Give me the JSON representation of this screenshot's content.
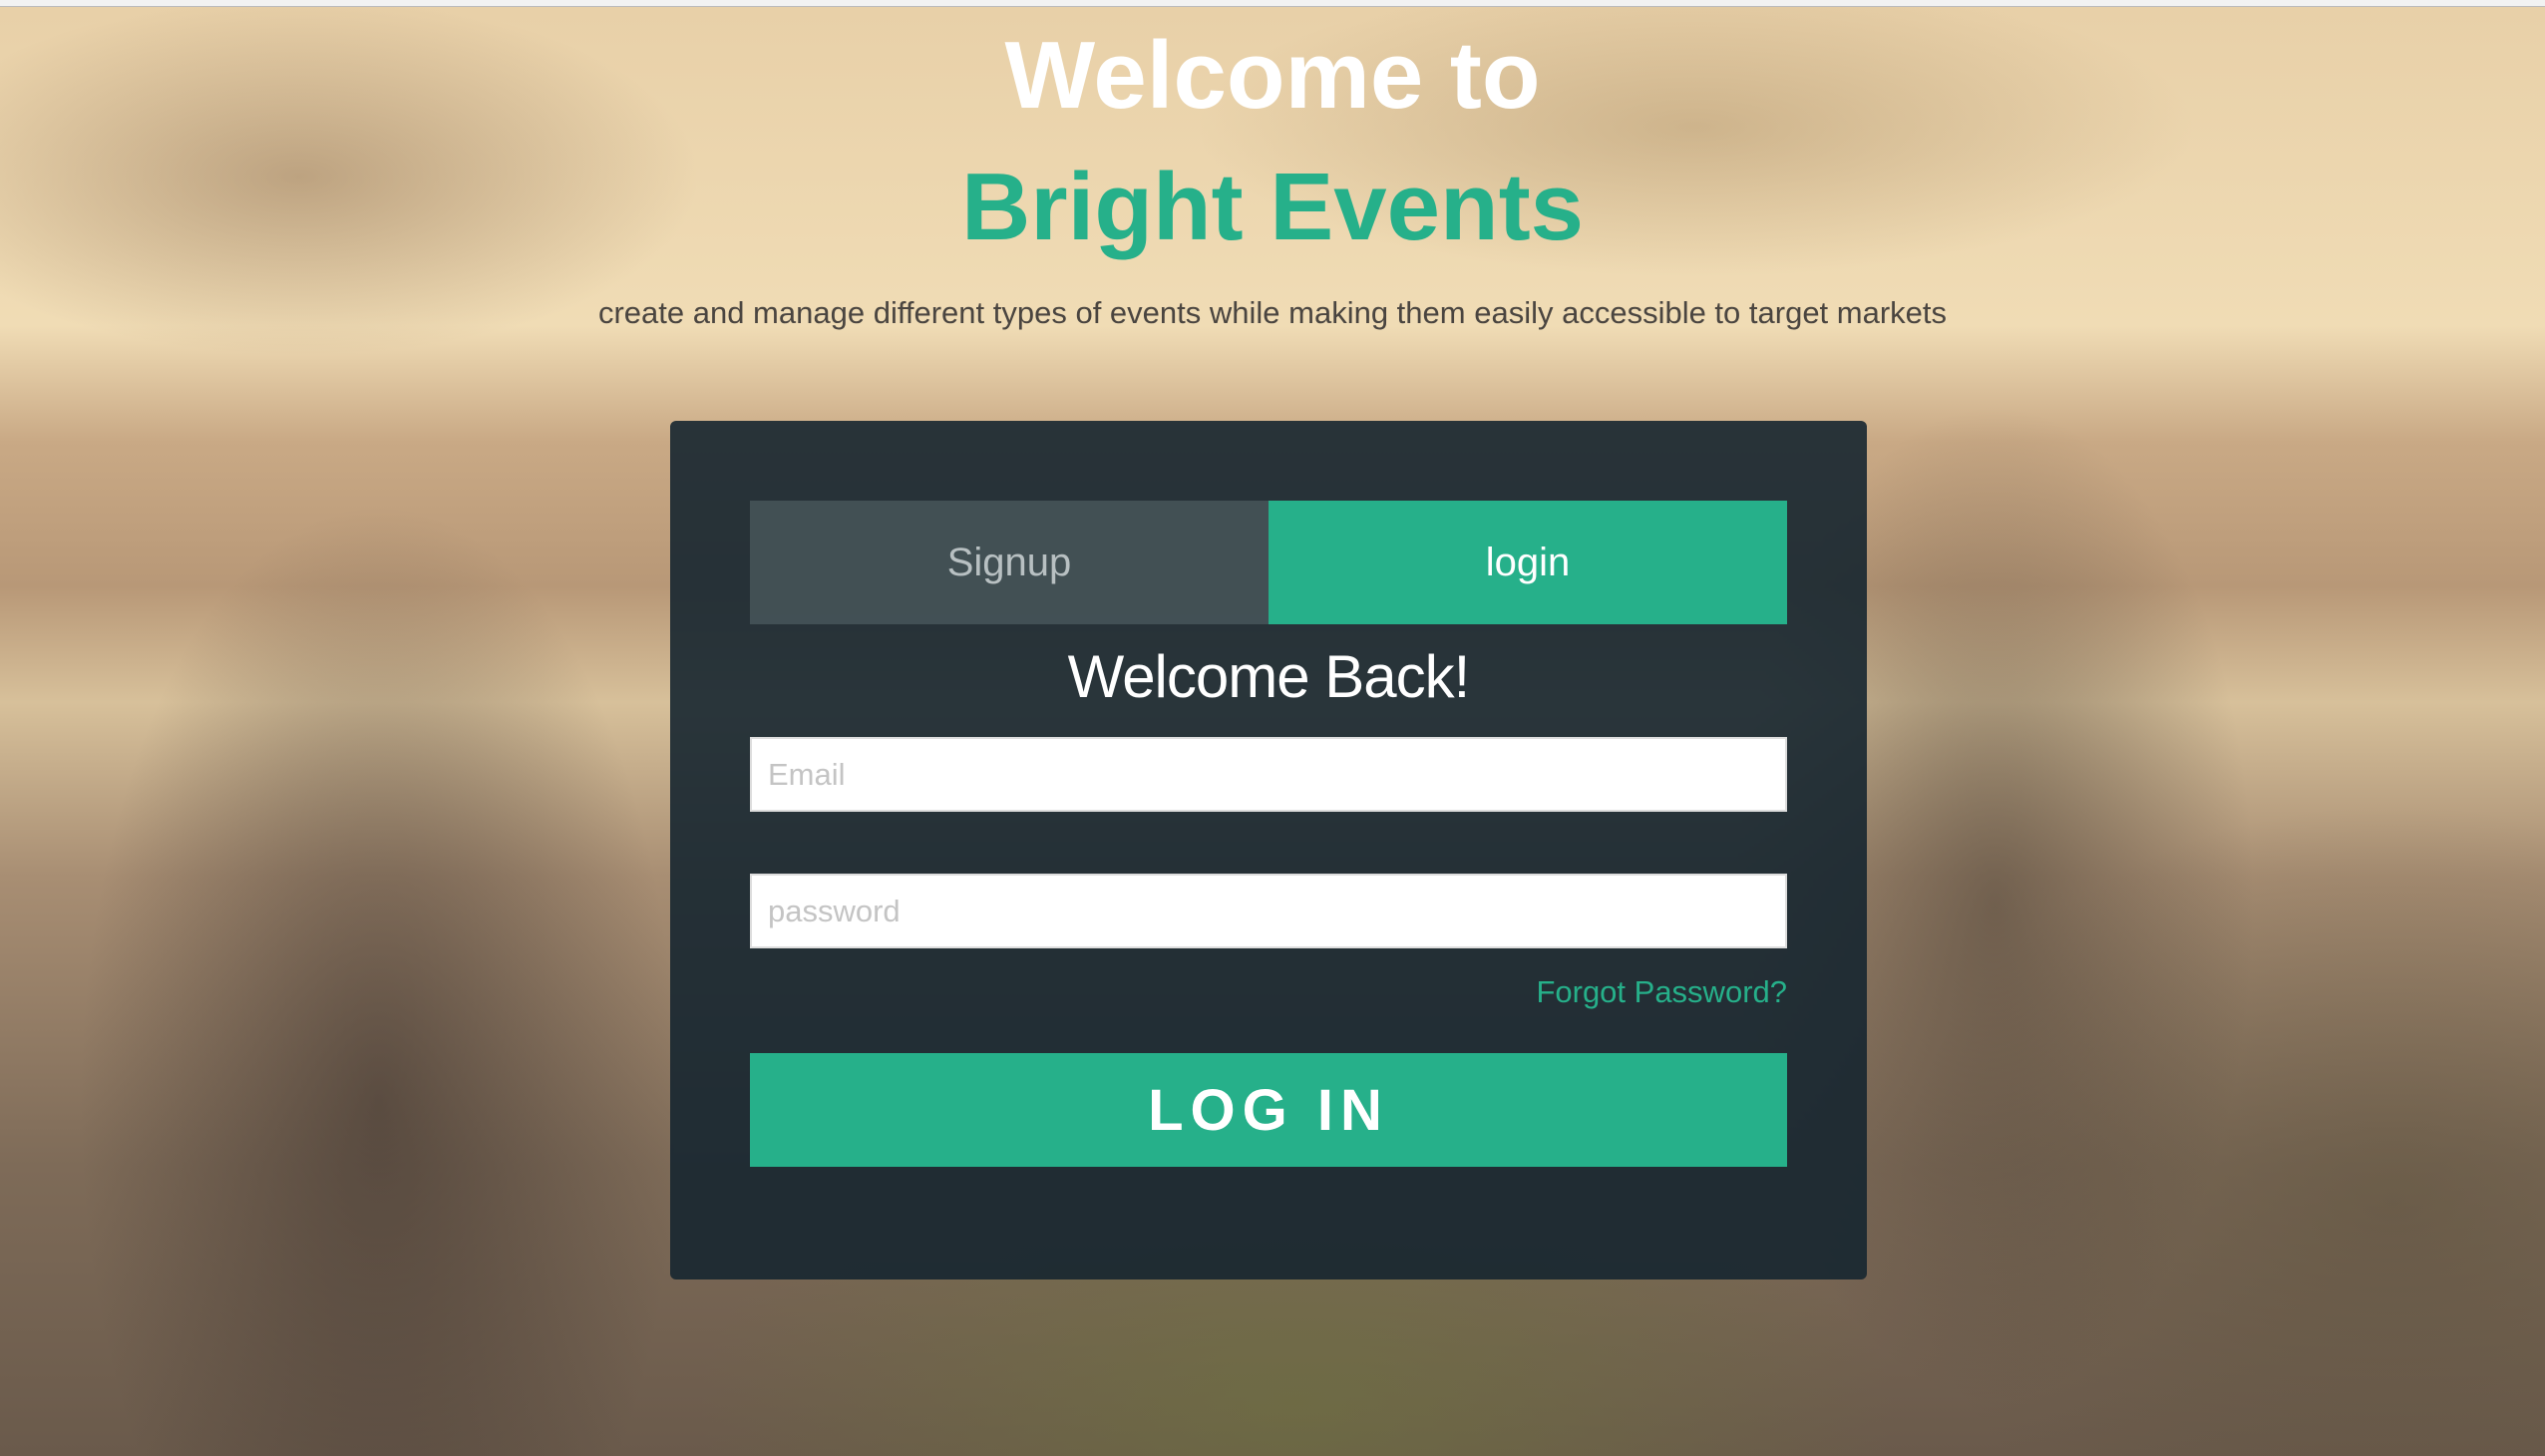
{
  "hero": {
    "title_line1": "Welcome to",
    "title_line2": "Bright Events",
    "subtitle": "create and manage different types of events while making them easily accessible to target markets"
  },
  "form": {
    "tabs": [
      {
        "label": "Signup",
        "active": false
      },
      {
        "label": "login",
        "active": true
      }
    ],
    "heading": "Welcome Back!",
    "email_placeholder": "Email",
    "email_value": "",
    "password_placeholder": "password",
    "password_value": "",
    "forgot_label": "Forgot Password?",
    "submit_label": "LOG IN"
  },
  "colors": {
    "accent": "#26b08a",
    "panel": "#162630"
  }
}
